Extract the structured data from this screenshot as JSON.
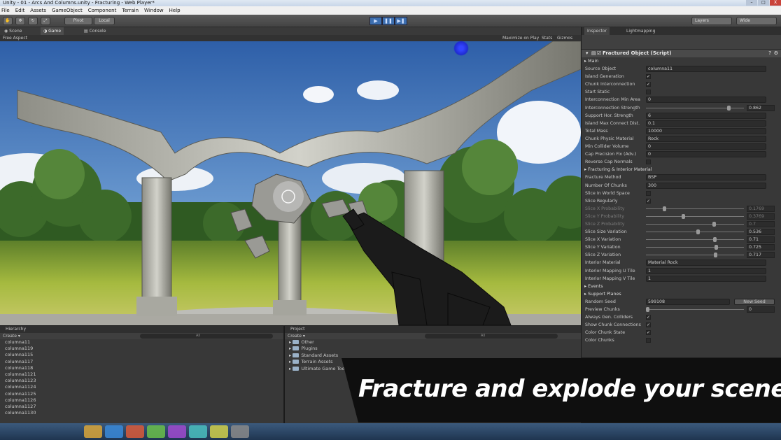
{
  "window": {
    "title": "Unity - 01 - Arcs And Columns.unity - Fracturing - Web Player*",
    "controls": [
      "–",
      "□",
      "X"
    ]
  },
  "menu": [
    "File",
    "Edit",
    "Assets",
    "GameObject",
    "Component",
    "Terrain",
    "Window",
    "Help"
  ],
  "toolbar": {
    "pivot_label": "Pivot",
    "local_label": "Local",
    "play_buttons": [
      "▶",
      "❚❚",
      "▶❚"
    ],
    "layers_label": "Layers",
    "layout_label": "Wide"
  },
  "scene_tabs": {
    "scene": "Scene",
    "game": "Game",
    "console": "Console"
  },
  "scene_bar": {
    "aspect": "Free Aspect",
    "maximize": "Maximize on Play",
    "stats": "Stats",
    "gizmos": "Gizmos"
  },
  "inspector": {
    "tabs": [
      "Inspector",
      "Lightmapping"
    ],
    "component_title": "Fractured Object (Script)",
    "rows": [
      {
        "kind": "section",
        "label": "Main"
      },
      {
        "kind": "text",
        "label": "Source Object",
        "value": "columna11"
      },
      {
        "kind": "check",
        "label": "Island Generation",
        "value": "✓"
      },
      {
        "kind": "check",
        "label": "Chunk Interconnection",
        "value": "✓"
      },
      {
        "kind": "check",
        "label": "Start Static",
        "value": ""
      },
      {
        "kind": "text",
        "label": "Interconnection Min Area",
        "value": "0"
      },
      {
        "kind": "slider",
        "label": "Interconnection Strength",
        "value": "0.862",
        "fraction": 0.862
      },
      {
        "kind": "text",
        "label": "Support Hor. Strength",
        "value": "6"
      },
      {
        "kind": "text",
        "label": "Island Max Connect Dist.",
        "value": "0.1"
      },
      {
        "kind": "text",
        "label": "Total Mass",
        "value": "10000"
      },
      {
        "kind": "text",
        "label": "Chunk Physic Material",
        "value": "Rock"
      },
      {
        "kind": "text",
        "label": "Min Collider Volume",
        "value": "0"
      },
      {
        "kind": "text",
        "label": "Cap Precision Fix (Adv.)",
        "value": "0"
      },
      {
        "kind": "check",
        "label": "Reverse Cap Normals",
        "value": ""
      },
      {
        "kind": "section",
        "label": "Fracturing & Interior Material"
      },
      {
        "kind": "text",
        "label": "Fracture Method",
        "value": "BSP"
      },
      {
        "kind": "text",
        "label": "Number Of Chunks",
        "value": "300"
      },
      {
        "kind": "check",
        "label": "Slice In World Space",
        "value": ""
      },
      {
        "kind": "check",
        "label": "Slice Regularly",
        "value": "✓"
      },
      {
        "kind": "slider",
        "label": "Slice X Probability",
        "value": "0.1769",
        "fraction": 0.18,
        "dim": true
      },
      {
        "kind": "slider",
        "label": "Slice Y Probability",
        "value": "0.3769",
        "fraction": 0.38,
        "dim": true
      },
      {
        "kind": "slider",
        "label": "Slice Z Probability",
        "value": "0.7",
        "fraction": 0.7,
        "dim": true
      },
      {
        "kind": "slider",
        "label": "Slice Size Variation",
        "value": "0.536",
        "fraction": 0.536
      },
      {
        "kind": "slider",
        "label": "Slice X Variation",
        "value": "0.71",
        "fraction": 0.71
      },
      {
        "kind": "slider",
        "label": "Slice Y Variation",
        "value": "0.725",
        "fraction": 0.725
      },
      {
        "kind": "slider",
        "label": "Slice Z Variation",
        "value": "0.717",
        "fraction": 0.717
      },
      {
        "kind": "text",
        "label": "Interior Material",
        "value": "Material Rock"
      },
      {
        "kind": "text",
        "label": "Interior Mapping U Tile",
        "value": "1"
      },
      {
        "kind": "text",
        "label": "Interior Mapping V Tile",
        "value": "1"
      },
      {
        "kind": "section",
        "label": "Events"
      },
      {
        "kind": "section",
        "label": "Support Planes"
      },
      {
        "kind": "button",
        "label": "Random Seed",
        "value": "599108",
        "button": "New Seed"
      },
      {
        "kind": "slider",
        "label": "Preview Chunks",
        "value": "0",
        "fraction": 0.0
      },
      {
        "kind": "check",
        "label": "Always Gen. Colliders",
        "value": "✓"
      },
      {
        "kind": "check",
        "label": "Show Chunk Connections",
        "value": "✓"
      },
      {
        "kind": "check",
        "label": "Color Chunk State",
        "value": "✓"
      },
      {
        "kind": "check",
        "label": "Color Chunks",
        "value": ""
      }
    ]
  },
  "hierarchy": {
    "title": "Hierarchy",
    "create": "Create ▾",
    "search": "All",
    "items": [
      "columna11",
      "columna119",
      "columna115",
      "columna117",
      "columna118",
      "columna1121",
      "columna1123",
      "columna1124",
      "columna1125",
      "columna1126",
      "columna1127",
      "columna1130"
    ]
  },
  "project": {
    "title": "Project",
    "create": "Create ▾",
    "search": "All",
    "folders": [
      "Other",
      "Plugins",
      "Standard Assets",
      "Terrain Assets",
      "Ultimate Game Tools"
    ]
  },
  "banner": {
    "text": "Fracture and explode your scene!"
  },
  "colors": {
    "accent": "#3d6fb0",
    "banner_bg": "#0f0f0f",
    "sky": "#4a78b8",
    "grass": "#8fae3a"
  }
}
